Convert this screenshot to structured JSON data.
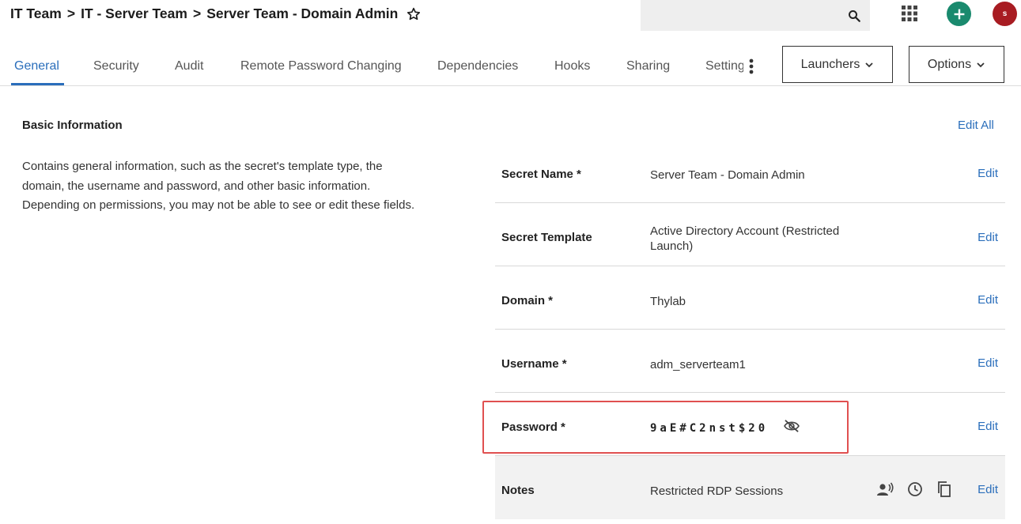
{
  "breadcrumb": {
    "items": [
      "IT Team",
      "IT - Server Team",
      "Server Team - Domain Admin"
    ],
    "separator": ">"
  },
  "search": {
    "placeholder": "",
    "value": ""
  },
  "avatar": {
    "initial": "s",
    "color": "#a81c22"
  },
  "add_button": {
    "color": "#1a8a6e"
  },
  "tabs": [
    {
      "label": "General",
      "active": true
    },
    {
      "label": "Security"
    },
    {
      "label": "Audit"
    },
    {
      "label": "Remote Password Changing"
    },
    {
      "label": "Dependencies"
    },
    {
      "label": "Hooks"
    },
    {
      "label": "Sharing"
    },
    {
      "label": "Setting"
    }
  ],
  "toolbar": {
    "launchers_label": "Launchers",
    "options_label": "Options"
  },
  "section": {
    "title": "Basic Information",
    "description": "Contains general information, such as the secret's template type, the domain, the username and password, and other basic information. Depending on permissions, you may not be able to see or edit these fields.",
    "edit_all_label": "Edit All"
  },
  "fields": [
    {
      "label": "Secret Name *",
      "value": "Server Team - Domain Admin",
      "edit": "Edit"
    },
    {
      "label": "Secret Template",
      "value": "Active Directory Account (Restricted Launch)",
      "edit": "Edit"
    },
    {
      "label": "Domain *",
      "value": "Thylab",
      "edit": "Edit"
    },
    {
      "label": "Username *",
      "value": "adm_serverteam1",
      "edit": "Edit"
    },
    {
      "label": "Password *",
      "value": "9aE#C2nst$20",
      "edit": "Edit"
    },
    {
      "label": "Notes",
      "value": "Restricted RDP Sessions",
      "edit": "Edit"
    }
  ],
  "colors": {
    "accent": "#2a6ebb",
    "highlight": "#e05050"
  }
}
